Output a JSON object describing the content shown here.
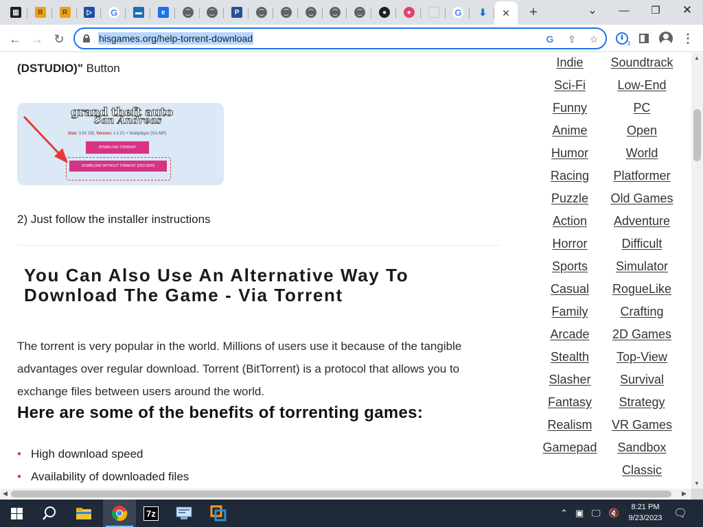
{
  "browser": {
    "tabs": [
      {
        "icon": "library-icon",
        "color": "#202124",
        "glyph": "▥"
      },
      {
        "icon": "r-logo-icon",
        "color": "#e8a317",
        "glyph": "R"
      },
      {
        "icon": "r-logo-icon",
        "color": "#e8a317",
        "glyph": "R"
      },
      {
        "icon": "play-box-icon",
        "color": "#1f4fa3",
        "glyph": "▷"
      },
      {
        "icon": "google-icon",
        "color": "#ffffff",
        "glyph": "G"
      },
      {
        "icon": "vimeo-icon",
        "color": "#1a6fb5",
        "glyph": "▬"
      },
      {
        "icon": "e-logo-icon",
        "color": "#1a73e8",
        "glyph": "e"
      },
      {
        "icon": "globe-icon",
        "color": "#5f6368",
        "glyph": ""
      },
      {
        "icon": "globe-icon",
        "color": "#5f6368",
        "glyph": ""
      },
      {
        "icon": "pr-logo-icon",
        "color": "#2a4d9b",
        "glyph": "P"
      },
      {
        "icon": "globe-icon",
        "color": "#5f6368",
        "glyph": ""
      },
      {
        "icon": "globe-icon",
        "color": "#5f6368",
        "glyph": ""
      },
      {
        "icon": "globe-icon",
        "color": "#5f6368",
        "glyph": ""
      },
      {
        "icon": "globe-icon",
        "color": "#5f6368",
        "glyph": ""
      },
      {
        "icon": "globe-icon",
        "color": "#5f6368",
        "glyph": ""
      },
      {
        "icon": "github-icon",
        "color": "#202124",
        "glyph": "●"
      },
      {
        "icon": "pink-circle-icon",
        "color": "#e3426b",
        "glyph": "●"
      },
      {
        "icon": "grey-page-icon",
        "color": "#e4e4e4",
        "glyph": ""
      },
      {
        "icon": "google-icon",
        "color": "#ffffff",
        "glyph": "G"
      },
      {
        "icon": "download-icon",
        "color": "#1a73e8",
        "glyph": "⬇"
      }
    ],
    "active_tab_close": "✕",
    "new_tab": "+",
    "tab_search": "⌄",
    "minimize": "—",
    "restore": "❐",
    "close": "✕",
    "url": "hisgames.org/help-torrent-download",
    "download_badge": "3"
  },
  "page": {
    "lead_bold": "(DSTUDIO)\"",
    "lead_rest": " Button",
    "screenshot": {
      "logo_line1": "grand theft auto",
      "logo_line2": "San Andreas",
      "size_label": "Size:",
      "size_value": " 3.91 GB, ",
      "version_label": "Version:",
      "version_value": " v 1.01 + Multiplayer (SA-MP)",
      "button1": "DOWNLOAD TORRENT",
      "button2": "DOWNLOAD WITHOUT TORRENT (DSTUDIO)"
    },
    "step2": "2) Just follow the installer instructions",
    "heading": "You Can Also Use An Alternative Way To Download The Game - Via Torrent",
    "paragraph": "The torrent is very popular in the world. Millions of users use it because of the tangible advantages over regular download. Torrent (BitTorrent) is a protocol that allows you to exchange files between users around the world.",
    "benefits_heading": "Here are some of the benefits of torrenting games:",
    "benefits": [
      "High download speed",
      "Availability of downloaded files"
    ]
  },
  "sidebar": {
    "left_column": [
      "Indie",
      "Sci-Fi",
      "Funny",
      "Anime",
      "Humor",
      "Racing",
      "Puzzle",
      "Action",
      "Horror",
      "Sports",
      "Casual",
      "Family",
      "Arcade",
      "Stealth",
      "Slasher",
      "Fantasy",
      "Realism",
      "Gamepad"
    ],
    "right_column": [
      "Soundtrack",
      "Low-End",
      "PC",
      "Open",
      "World",
      "Platformer",
      "Old Games",
      "Adventure",
      "Difficult",
      "Simulator",
      "RogueLike",
      "Crafting",
      "2D Games",
      "Top-View",
      "Survival",
      "Strategy",
      "VR Games",
      "Sandbox",
      "Classic"
    ]
  },
  "taskbar": {
    "time": "8:21 PM",
    "date": "9/23/2023",
    "apps": [
      "start",
      "search",
      "file-explorer",
      "chrome",
      "7zip",
      "control-panel",
      "vmware"
    ],
    "zip_label": "7z"
  }
}
